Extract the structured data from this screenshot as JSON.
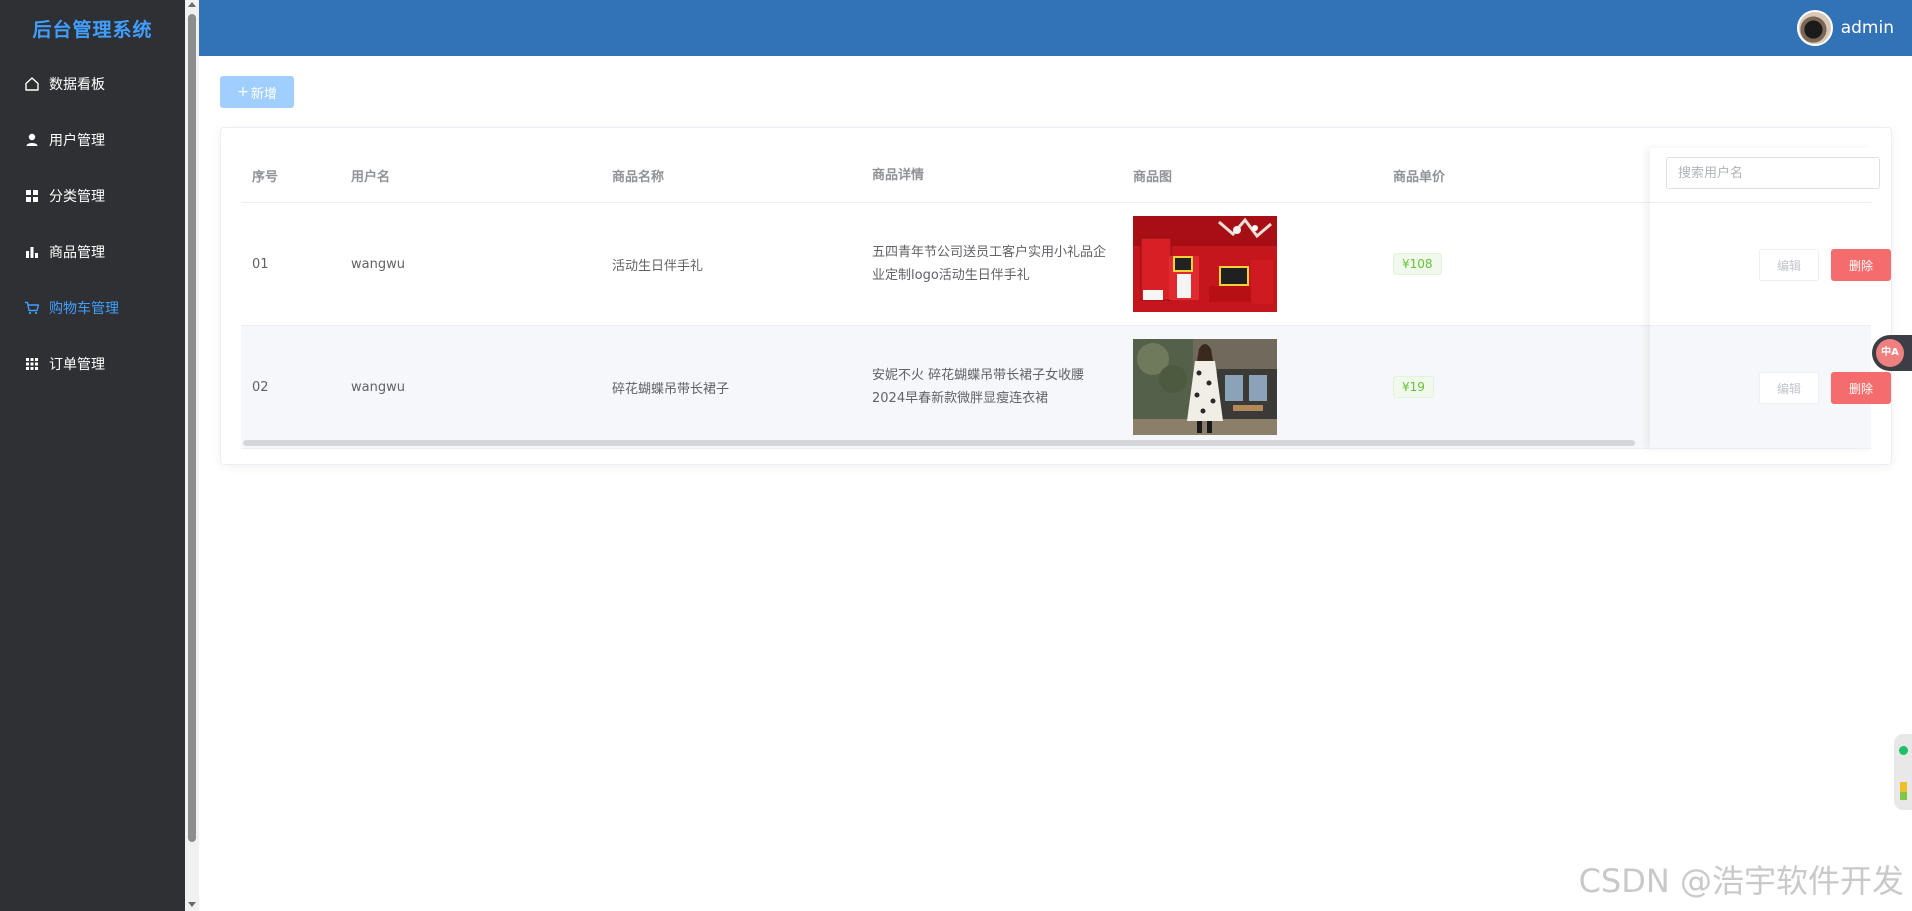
{
  "sidebar": {
    "title": "后台管理系统",
    "items": [
      {
        "label": "数据看板",
        "icon": "home-icon",
        "active": false
      },
      {
        "label": "用户管理",
        "icon": "user-icon",
        "active": false
      },
      {
        "label": "分类管理",
        "icon": "grid-icon",
        "active": false
      },
      {
        "label": "商品管理",
        "icon": "bar-chart-icon",
        "active": false
      },
      {
        "label": "购物车管理",
        "icon": "cart-icon",
        "active": true
      },
      {
        "label": "订单管理",
        "icon": "apps-icon",
        "active": false
      }
    ]
  },
  "header": {
    "username": "admin"
  },
  "toolbar": {
    "add_label": "新增",
    "add_icon": "plus-icon"
  },
  "search": {
    "placeholder": "搜索用户名"
  },
  "table": {
    "columns": [
      "序号",
      "用户名",
      "商品名称",
      "商品详情",
      "商品图",
      "商品单价"
    ],
    "rows": [
      {
        "index": "01",
        "username": "wangwu",
        "product_name": "活动生日伴手礼",
        "detail": "五四青年节公司送员工客户实用小礼品企业定制logo活动生日伴手礼",
        "image": "red-gift-bags-image",
        "price": "¥108",
        "edit_label": "编辑",
        "delete_label": "删除"
      },
      {
        "index": "02",
        "username": "wangwu",
        "product_name": "碎花蝴蝶吊带长裙子",
        "detail": "安妮不火 碎花蝴蝶吊带长裙子女收腰2024早春新款微胖显瘦连衣裙",
        "image": "floral-dress-photo-image",
        "price": "¥19",
        "edit_label": "编辑",
        "delete_label": "删除"
      }
    ]
  },
  "translate_button": {
    "label": "中A"
  },
  "watermark": "CSDN @浩宇软件开发",
  "colors": {
    "sidebar_bg": "#2e3033",
    "header_bg": "#3273b8",
    "accent": "#409eff",
    "danger": "#f56c6c",
    "success": "#67c23a"
  }
}
